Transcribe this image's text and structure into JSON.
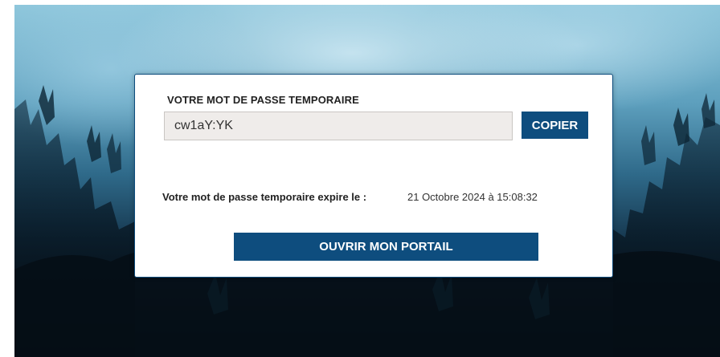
{
  "card": {
    "password_label": "VOTRE MOT DE PASSE TEMPORAIRE",
    "password_value": "cw1aY:YK",
    "copy_label": "COPIER",
    "expiry_label": "Votre mot de passe temporaire expire le :",
    "expiry_value": "21 Octobre 2024 à 15:08:32",
    "portal_label": "OUVRIR MON PORTAIL"
  },
  "colors": {
    "accent": "#0e4d7e",
    "field_background": "#efecea"
  },
  "background": {
    "image_subject": "concert-crowd-photo"
  }
}
